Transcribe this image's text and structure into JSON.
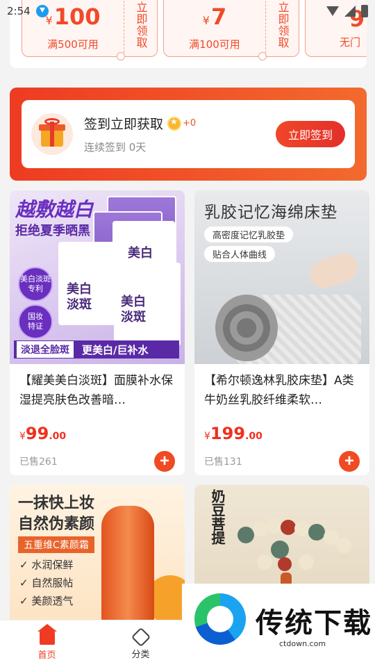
{
  "status_bar": {
    "time": "2:54"
  },
  "coupons": [
    {
      "amount": "100",
      "yen": "¥",
      "condition": "满500可用",
      "claim": "立即领取"
    },
    {
      "amount": "7",
      "yen": "¥",
      "condition": "满100可用",
      "claim": "立即领取"
    },
    {
      "amount": "9",
      "yen": "",
      "condition": "无门",
      "claim": ""
    }
  ],
  "signin": {
    "title": "签到立即获取",
    "coins": "+0",
    "subtitle": "连续签到 0天",
    "button": "立即签到"
  },
  "products": [
    {
      "title": "【耀美美白淡斑】面膜补水保湿提亮肤色改善暗…",
      "price_yen": "¥",
      "price_int": "99",
      "price_dec": ".00",
      "sold": "已售261",
      "image": {
        "headline": "越敷越白",
        "sub": "拒绝夏季晒黑",
        "label1": "美白",
        "label2": "美白\n淡斑",
        "label3": "美白\n淡斑",
        "badge1": "美白淡斑\n专利",
        "badge2": "国妆\n特证",
        "banner_a": "淡退全脸斑",
        "banner_b": "更美白/巨补水"
      }
    },
    {
      "title": "【希尔顿逸林乳胶床垫】A类牛奶丝乳胶纤维柔软…",
      "price_yen": "¥",
      "price_int": "199",
      "price_dec": ".00",
      "sold": "已售131",
      "image": {
        "headline": "乳胶记忆海绵床垫",
        "tag1": "高密度记忆乳胶垫",
        "tag2": "贴合人体曲线"
      }
    },
    {
      "image": {
        "headline": "一抹快上妆\n自然伪素颜",
        "tag": "五重维C素颜霜",
        "bullets": [
          "水润保鲜",
          "自然服帖",
          "美颜透气"
        ]
      }
    },
    {
      "image": {
        "headline": "奶豆菩提"
      }
    }
  ],
  "bottom_nav": [
    {
      "label": "首页",
      "icon": "home-icon"
    },
    {
      "label": "分类",
      "icon": "category-icon"
    }
  ],
  "watermark": {
    "text": "传统下载",
    "url": "ctdown.com"
  },
  "colors": {
    "accent": "#ef3b22",
    "coupon_border": "#f2a08a"
  }
}
